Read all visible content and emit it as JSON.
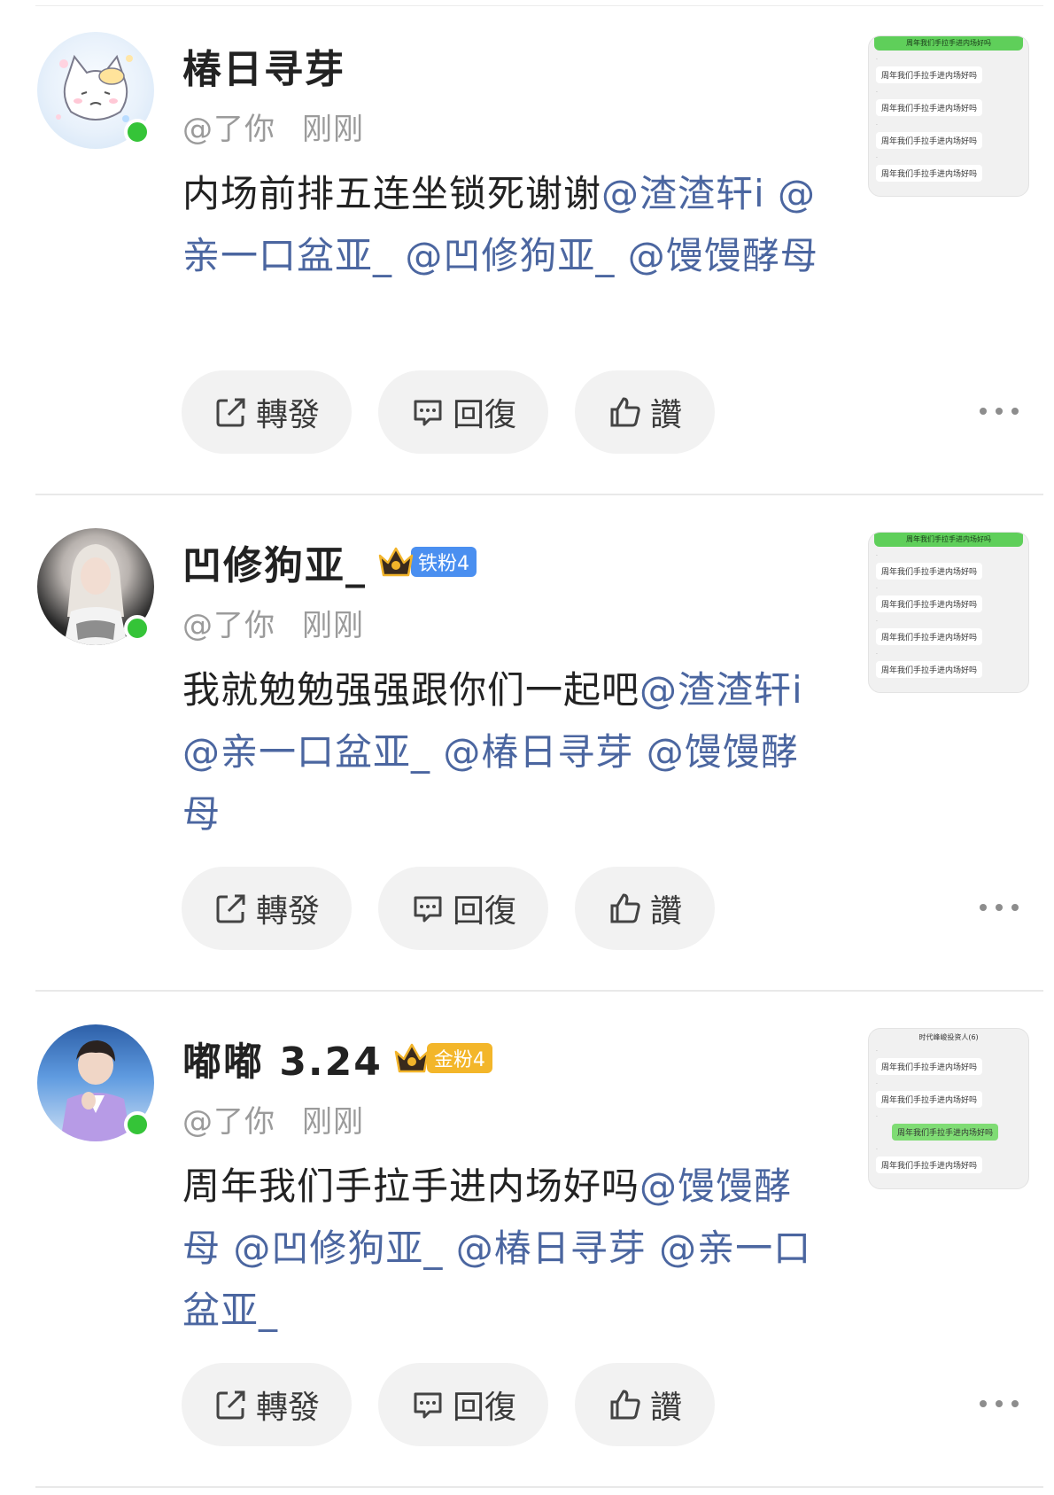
{
  "posts": [
    {
      "username": "椿日寻芽",
      "badge": null,
      "handle": "@了你",
      "time": "刚刚",
      "text_plain": "内场前排五连坐锁死谢谢",
      "mentions": [
        "@渣渣轩i",
        "@亲一口盆亚_",
        "@凹修狗亚_",
        "@馒馒酵母"
      ],
      "thumb": {
        "header": "周年我们手拉手进内场好吗",
        "messages": [
          "周年我们手拉手进内场好吗",
          "周年我们手拉手进内场好吗",
          "周年我们手拉手进内场好吗",
          "周年我们手拉手进内场好吗"
        ]
      }
    },
    {
      "username": "凹修狗亚_",
      "badge": {
        "label": "铁粉4",
        "color": "#4a8ff0"
      },
      "handle": "@了你",
      "time": "刚刚",
      "text_plain": "我就勉勉强强跟你们一起吧",
      "mentions": [
        "@渣渣轩i",
        "@亲一口盆亚_",
        "@椿日寻芽",
        "@馒馒酵母"
      ],
      "thumb": {
        "header": "周年我们手拉手进内场好吗",
        "messages": [
          "周年我们手拉手进内场好吗",
          "周年我们手拉手进内场好吗",
          "周年我们手拉手进内场好吗",
          "周年我们手拉手进内场好吗"
        ]
      }
    },
    {
      "username": "嘟嘟 3.24",
      "badge": {
        "label": "金粉4",
        "color": "#f3b62a"
      },
      "handle": "@了你",
      "time": "刚刚",
      "text_plain": "周年我们手拉手进内场好吗",
      "mentions": [
        "@馒馒酵母",
        "@凹修狗亚_",
        "@椿日寻芽",
        "@亲一口盆亚_"
      ],
      "thumb": {
        "header": "时代峰峻投资人(6)",
        "messages": [
          "周年我们手拉手进内场好吗",
          "周年我们手拉手进内场好吗",
          "周年我们手拉手进内场好吗",
          "周年我们手拉手进内场好吗"
        ]
      }
    }
  ],
  "actions": {
    "repost": "轉發",
    "reply": "回復",
    "like": "讚"
  },
  "colors": {
    "mention": "#4b66a0",
    "online": "#35c438",
    "button_bg": "#f2f2f2"
  }
}
